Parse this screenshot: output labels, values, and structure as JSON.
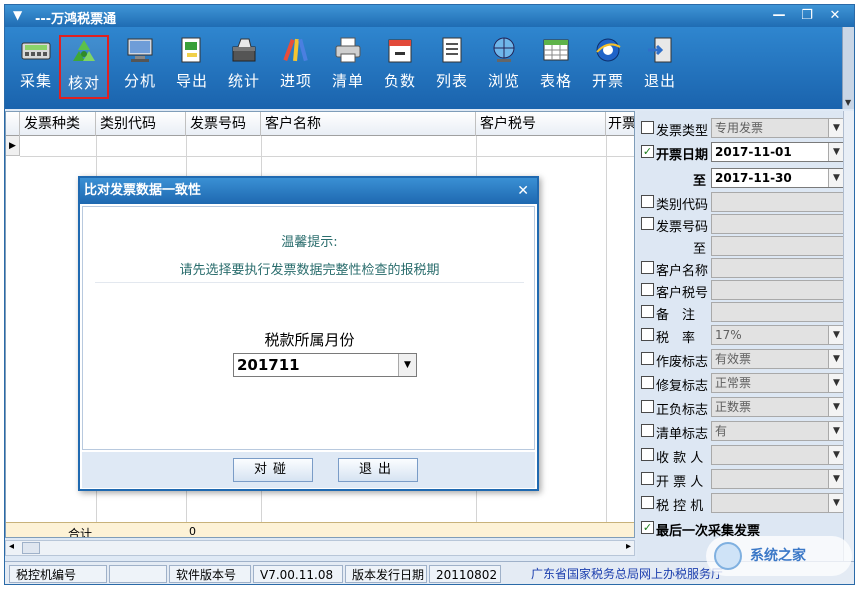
{
  "window": {
    "title": "---万鸿税票通",
    "menu_glyph": "▼",
    "minimize": "—",
    "restore": "❐",
    "close": "✕"
  },
  "toolbar": {
    "items": [
      {
        "label": "采集",
        "icon": "calculator-icon"
      },
      {
        "label": "核对",
        "icon": "recycle-icon",
        "selected": true
      },
      {
        "label": "分机",
        "icon": "monitor-icon"
      },
      {
        "label": "导出",
        "icon": "export-icon"
      },
      {
        "label": "统计",
        "icon": "toolbox-icon"
      },
      {
        "label": "进项",
        "icon": "pencils-icon"
      },
      {
        "label": "清单",
        "icon": "printer-icon"
      },
      {
        "label": "负数",
        "icon": "calendar-minus-icon"
      },
      {
        "label": "列表",
        "icon": "list-doc-icon"
      },
      {
        "label": "浏览",
        "icon": "globe-icon"
      },
      {
        "label": "表格",
        "icon": "spreadsheet-icon"
      },
      {
        "label": "开票",
        "icon": "ie-icon"
      },
      {
        "label": "退出",
        "icon": "exit-door-icon"
      }
    ]
  },
  "grid": {
    "columns": [
      "发票种类",
      "类别代码",
      "发票号码",
      "客户名称",
      "客户税号",
      "开票"
    ],
    "row_indicator": "▶",
    "sum_label": "合计",
    "sum_value": "0"
  },
  "status": {
    "device_label": "税控机编号",
    "device_value": "",
    "version_label": "软件版本号",
    "version_value": "V7.00.11.08",
    "release_label": "版本发行日期",
    "release_value": "20110802",
    "authority": "广东省国家税务总局网上办税服务厅"
  },
  "filters": {
    "invoice_type": {
      "label": "发票类型",
      "value": "专用发票",
      "checked": false
    },
    "date_from": {
      "label": "开票日期",
      "value": "2017-11-01",
      "checked": true
    },
    "date_to": {
      "label": "至",
      "value": "2017-11-30"
    },
    "category_code": {
      "label": "类别代码",
      "value": ""
    },
    "invoice_no": {
      "label": "发票号码",
      "value": ""
    },
    "invoice_no_to": {
      "label": "至",
      "value": ""
    },
    "customer_name": {
      "label": "客户名称",
      "value": ""
    },
    "customer_tax_id": {
      "label": "客户税号",
      "value": ""
    },
    "remark": {
      "label": "备　注",
      "value": ""
    },
    "tax_rate": {
      "label": "税　率",
      "value": "17%"
    },
    "void_flag": {
      "label": "作废标志",
      "value": "有效票"
    },
    "repair_flag": {
      "label": "修复标志",
      "value": "正常票"
    },
    "sign_flag": {
      "label": "正负标志",
      "value": "正数票"
    },
    "list_flag": {
      "label": "清单标志",
      "value": "有"
    },
    "payee": {
      "label": "收 款 人",
      "value": ""
    },
    "issuer": {
      "label": "开 票 人",
      "value": ""
    },
    "tax_device": {
      "label": "税 控 机",
      "value": ""
    },
    "last_collect": {
      "label": "最后一次采集发票",
      "checked": true
    },
    "check_glyph": "✓",
    "dropdown_glyph": "▼"
  },
  "dialog": {
    "title": "比对发票数据一致性",
    "close": "✕",
    "hint_title": "温馨提示:",
    "hint_text": "请先选择要执行发票数据完整性检查的报税期",
    "period_label": "税款所属月份",
    "period_value": "201711",
    "match_button": "对碰",
    "exit_button": "退出"
  },
  "watermark": {
    "text": "系统之家"
  }
}
